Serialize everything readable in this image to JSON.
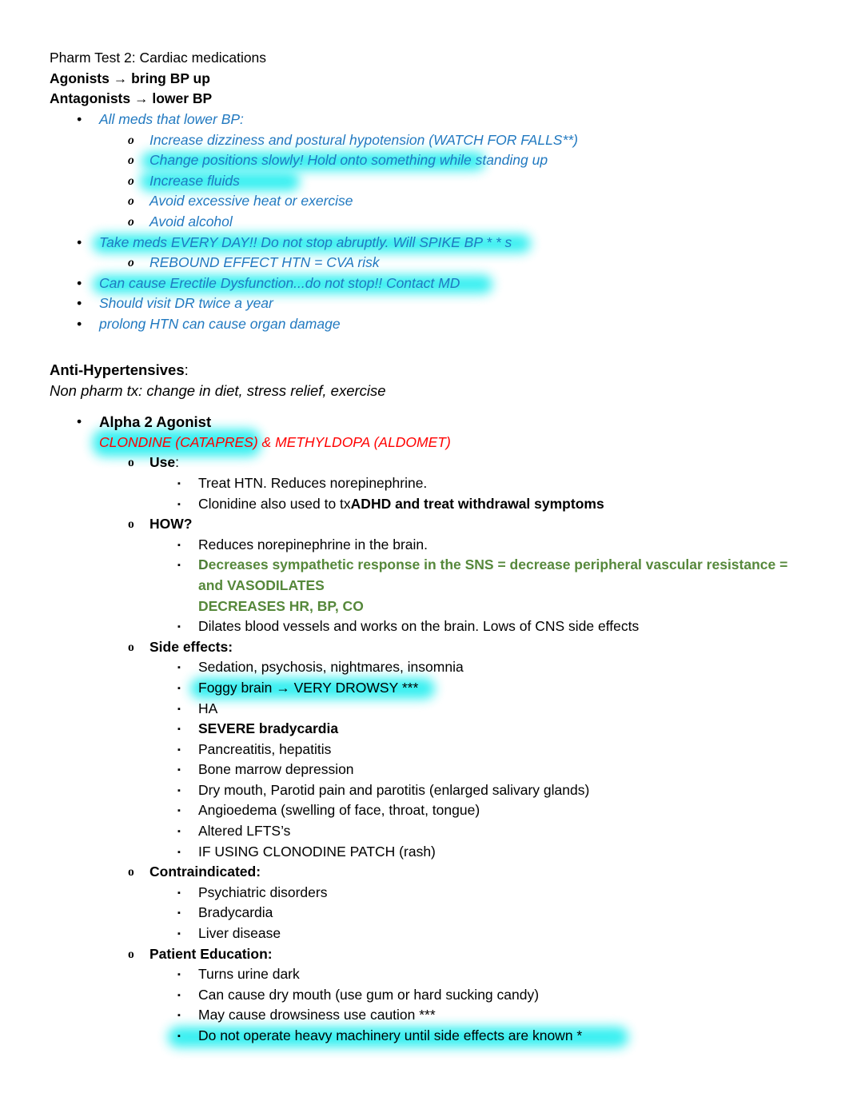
{
  "document": {
    "title": "Pharm Test 2: Cardiac medications",
    "colors": {
      "blue": "#2179C0",
      "red": "#FF0000",
      "green": "#56883B",
      "highlight_cyan": "#2DEFF0",
      "text_black": "#000000",
      "page_background": "#FFFFFF"
    }
  },
  "header": {
    "title": "Pharm Test 2: Cardiac medications",
    "agonists": {
      "term": "Agonists",
      "arrow": "arrow-right-icon",
      "definition": "bring BP up",
      "full": "Agonists → bring BP up"
    },
    "antagonists": {
      "term": "Antagonists",
      "arrow": "arrow-right-icon",
      "definition": "lower BP",
      "full": "Antagonists → lower BP"
    }
  },
  "lower_bp_section": {
    "heading": "All meds that lower BP:",
    "sub_items": [
      "Increase dizziness and postural hypotension (WATCH FOR FALLS**)",
      "Change positions slowly! Hold onto something while standing up",
      "Increase fluids",
      "Avoid excessive heat or exercise",
      "Avoid alcohol"
    ],
    "bullets": [
      "Take meds EVERY DAY!! Do not stop abruptly. Will SPIKE BP * * s",
      "Can cause Erectile Dysfunction...do not stop!! Contact MD",
      "Should visit DR twice a year",
      "prolong HTN can cause organ damage"
    ],
    "rebound": "REBOUND EFFECT HTN = CVA risk"
  },
  "antihypertensives": {
    "heading": "Anti-Hypertensives",
    "heading_colon": ":",
    "non_pharm": "Non pharm tx: change in diet, stress relief, exercise",
    "drug_class": "Alpha 2 Agonist",
    "drug_names": "CLONDINE (CATAPRES) & METHYLDOPA (ALDOMET)",
    "use": {
      "label": "Use",
      "label_colon": ":",
      "items": [
        " Treat HTN. Reduces norepinephrine.",
        "Clonidine also used to tx "
      ],
      "item2_bold": "ADHD and treat withdrawal symptoms"
    },
    "how": {
      "label": "HOW?",
      "item1": "Reduces norepinephrine in the brain.",
      "green_lead": "D",
      "green_line1": "ecreases sympathetic response in the SNS = decrease peripheral vascular resistance =",
      "green_line2": "and VASODILATES",
      "green_line3": "DECREASES HR, BP, CO",
      "item3": "Dilates blood vessels and works on the brain. Lows of CNS side effects"
    },
    "side_effects": {
      "label": "Side effects",
      "label_colon": ":",
      "items": [
        "Sedation, psychosis, nightmares, insomnia",
        "Foggy brain → VERY DROWSY ***",
        "HA",
        "SEVERE bradycardia",
        "Pancreatitis, hepatitis",
        "Bone marrow depression",
        "Dry mouth, Parotid pain and parotitis (enlarged salivary glands)",
        "Angioedema (swelling of face, throat, tongue)",
        "Altered LFTS’s",
        "IF USING CLONODINE PATCH (rash)"
      ]
    },
    "contraindicated": {
      "label": "Contraindicated:",
      "items": [
        "Psychiatric disorders",
        "Bradycardia",
        "Liver disease"
      ]
    },
    "patient_education": {
      "label": "Patient Education:",
      "items": [
        "Turns urine dark",
        "Can cause dry mouth (use gum or hard sucking candy)",
        "May cause drowsiness use caution ***",
        "Do not operate heavy machinery until side effects are known *"
      ]
    }
  },
  "bullet_glyphs": {
    "level1": "•",
    "level2": "o",
    "level3": "▪"
  }
}
